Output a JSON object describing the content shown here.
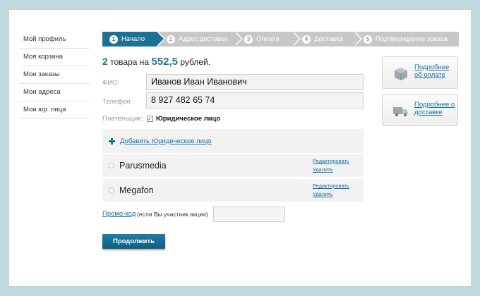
{
  "sidebar": {
    "items": [
      {
        "label": "Мой профиль"
      },
      {
        "label": "Моя корзина"
      },
      {
        "label": "Мои заказы"
      },
      {
        "label": "Мои адреса"
      },
      {
        "label": "Мои юр. лица"
      }
    ]
  },
  "steps": [
    {
      "num": "1",
      "label": "Начало",
      "active": true
    },
    {
      "num": "2",
      "label": "Адрес доставки",
      "active": false
    },
    {
      "num": "3",
      "label": "Оплата",
      "active": false
    },
    {
      "num": "4",
      "label": "Доставка",
      "active": false
    },
    {
      "num": "5",
      "label": "Подтверждение заказа",
      "active": false
    }
  ],
  "summary": {
    "count": "2",
    "text1": "товара на",
    "amount": "552,5",
    "text2": "рублей."
  },
  "form": {
    "fio_label": "ФИО:",
    "fio_value": "Иванов Иван Иванович",
    "phone_label": "Телефон:",
    "phone_value": "8 927 482 65 74",
    "payer_label": "Плательщик:",
    "payer_checkbox_label": "Юридическое лицо",
    "payer_checked": true
  },
  "legal": {
    "add_label": "Добавить Юридическое лицо",
    "edit_label": "Редактировать",
    "delete_label": "Удалить",
    "entities": [
      {
        "name": "Parusmedia"
      },
      {
        "name": "Megafon"
      }
    ]
  },
  "promo": {
    "link_label": "Промо-код",
    "note": "(если Вы участник акции)",
    "value": ""
  },
  "continue_label": "Продолжить",
  "info": {
    "payment_label": "Подробнее об оплате",
    "delivery_label": "Подробнее о доставке"
  },
  "colors": {
    "accent": "#1a7295",
    "link": "#1a6fa8",
    "background": "#bfd9df"
  }
}
